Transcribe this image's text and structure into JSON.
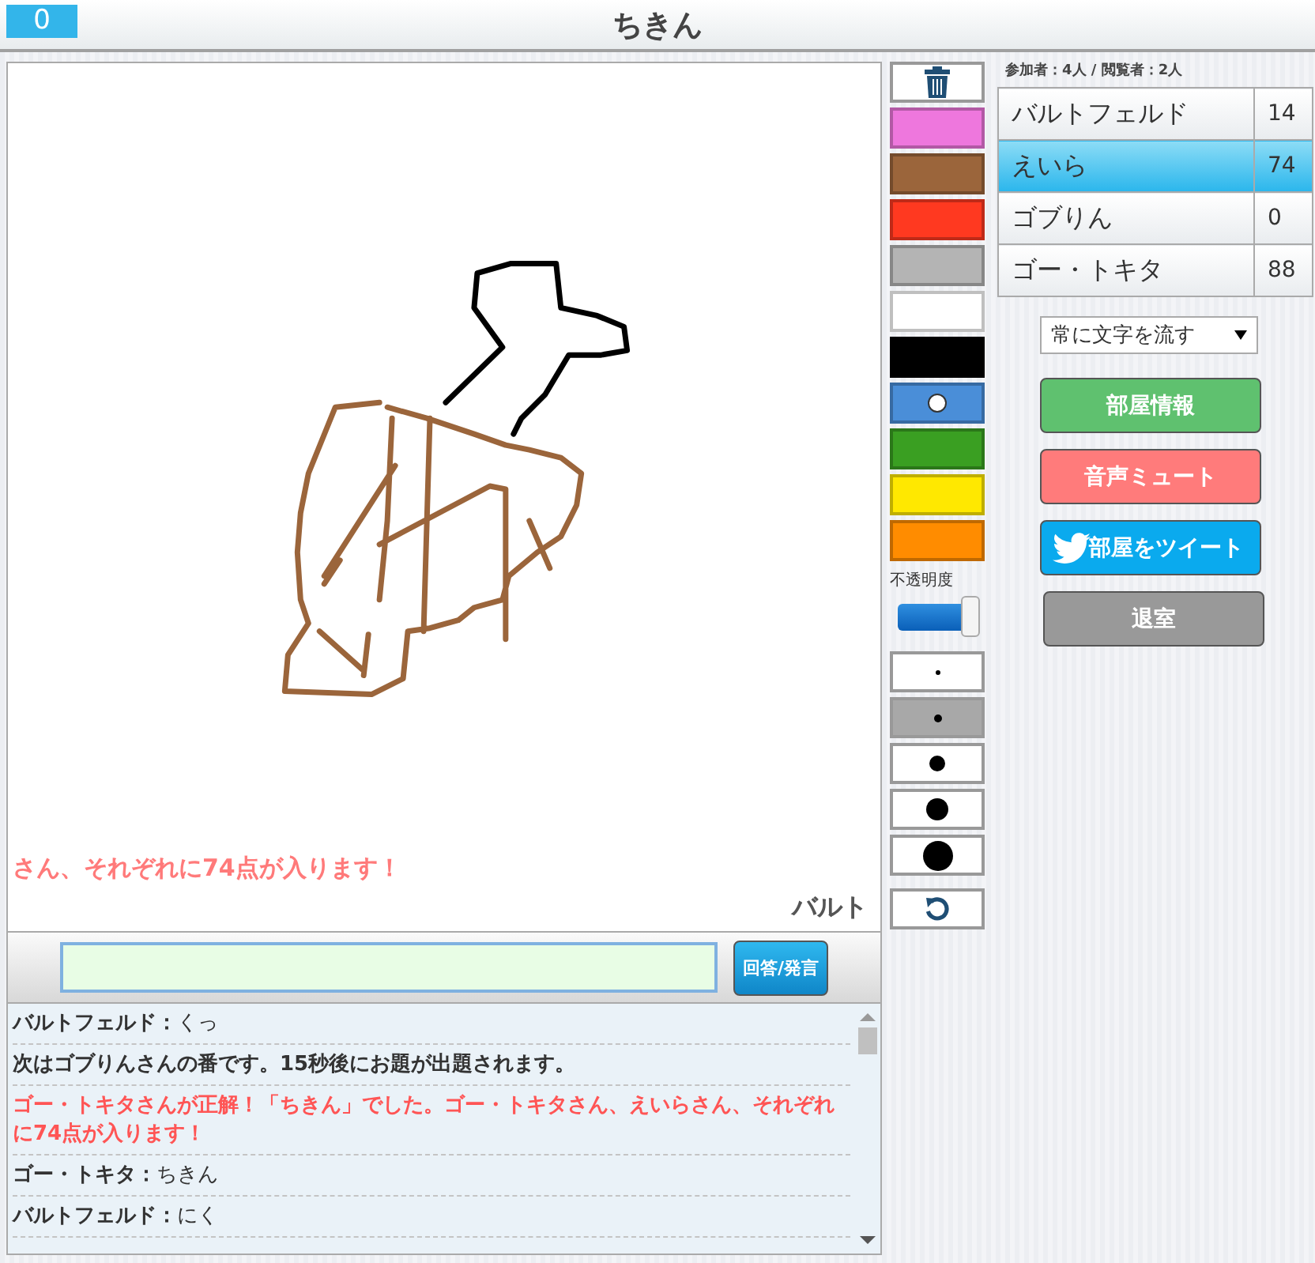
{
  "header": {
    "score": "0",
    "title": "ちきん"
  },
  "canvas": {
    "flow_texts": [
      {
        "text": "さん、それぞれに74点が入ります！",
        "kind": "correct"
      },
      {
        "text": "バルト",
        "kind": "name"
      }
    ]
  },
  "answer": {
    "button": "回答/発言"
  },
  "chat": [
    {
      "kind": "chat",
      "name": "バルトフェルド：",
      "text": "くっ"
    },
    {
      "kind": "system",
      "text": "次はゴブりんさんの番です。15秒後にお題が出題されます。"
    },
    {
      "kind": "correct",
      "text": "ゴー・トキタさんが正解！「ちきん」でした。ゴー・トキタさん、えいらさん、それぞれに74点が入ります！"
    },
    {
      "kind": "chat",
      "name": "ゴー・トキタ：",
      "text": "ちきん"
    },
    {
      "kind": "chat",
      "name": "バルトフェルド：",
      "text": "にく"
    }
  ],
  "palette": [
    {
      "color": "#ee77dd",
      "selected": false
    },
    {
      "color": "#9b653b",
      "selected": false
    },
    {
      "color": "#ff3920",
      "selected": false
    },
    {
      "color": "#b4b4b4",
      "selected": false
    },
    {
      "color": "#ffffff",
      "selected": false
    },
    {
      "color": "#000000",
      "selected": false
    },
    {
      "color": "#4a8ed8",
      "selected": true
    },
    {
      "color": "#3a9f22",
      "selected": false
    },
    {
      "color": "#ffe800",
      "selected": false
    },
    {
      "color": "#ff8c00",
      "selected": false
    }
  ],
  "opacity": {
    "label": "不透明度",
    "level": 0.95
  },
  "brush_sizes": [
    {
      "selected": false
    },
    {
      "selected": true
    },
    {
      "selected": false
    },
    {
      "selected": false
    },
    {
      "selected": false
    }
  ],
  "room": {
    "counts": "参加者：4人 / 閲覧者：2人",
    "players": [
      {
        "name": "バルトフェルド",
        "score": "14",
        "selected": false
      },
      {
        "name": "えいら",
        "score": "74",
        "selected": true
      },
      {
        "name": "ゴブりん",
        "score": "0",
        "selected": false
      },
      {
        "name": "ゴー・トキタ",
        "score": "88",
        "selected": false
      }
    ],
    "flow_select": "常に文字を流す",
    "buttons": [
      {
        "kind": "info",
        "label": "部屋情報"
      },
      {
        "kind": "mute",
        "label": "音声ミュート"
      },
      {
        "kind": "tweet",
        "label": "部屋をツイート"
      },
      {
        "kind": "leave",
        "label": "退室"
      }
    ]
  }
}
